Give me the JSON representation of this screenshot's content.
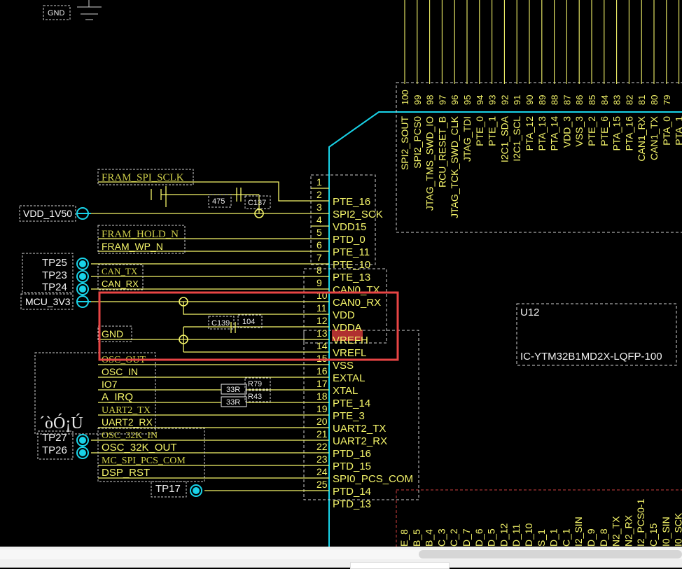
{
  "colors": {
    "wire": "#f5f56a",
    "body": "#19d3e8",
    "highlight": "#e84545",
    "vdda_bg": "#b03030",
    "tp": "#19d3e8",
    "dashed": "#cfcfcf",
    "dashed_red": "#d04040"
  },
  "ic": {
    "ref": "U12",
    "part": "IC-YTM32B1MD2X-LQFP-100",
    "left_pins": [
      {
        "num": "1",
        "name": ""
      },
      {
        "num": "2",
        "name": "PTE_16"
      },
      {
        "num": "3",
        "name": "SPI2_SCK"
      },
      {
        "num": "4",
        "name": "VDD15"
      },
      {
        "num": "5",
        "name": "PTD_0"
      },
      {
        "num": "6",
        "name": "PTE_11"
      },
      {
        "num": "7",
        "name": "PTE_10"
      },
      {
        "num": "8",
        "name": "PTE_13"
      },
      {
        "num": "9",
        "name": "CAN0_TX"
      },
      {
        "num": "10",
        "name": "CAN0_RX"
      },
      {
        "num": "11",
        "name": "VDD"
      },
      {
        "num": "12",
        "name": "VDDA"
      },
      {
        "num": "13",
        "name": "VREFH"
      },
      {
        "num": "14",
        "name": "VREFL"
      },
      {
        "num": "15",
        "name": "VSS"
      },
      {
        "num": "16",
        "name": "EXTAL"
      },
      {
        "num": "17",
        "name": "XTAL"
      },
      {
        "num": "18",
        "name": "PTE_14"
      },
      {
        "num": "19",
        "name": "PTE_3"
      },
      {
        "num": "20",
        "name": "UART2_TX"
      },
      {
        "num": "21",
        "name": "UART2_RX"
      },
      {
        "num": "22",
        "name": "PTD_16"
      },
      {
        "num": "23",
        "name": "PTD_15"
      },
      {
        "num": "24",
        "name": "SPI0_PCS_COM"
      },
      {
        "num": "25",
        "name": "PTD_14"
      },
      {
        "num": "",
        "name": "PTD_13"
      }
    ],
    "top_pins": [
      {
        "num": "100",
        "name": "SPI2_SOUT"
      },
      {
        "num": "99",
        "name": "SPI2_PCS0"
      },
      {
        "num": "98",
        "name": "JTAG_TMS_SWD_IO"
      },
      {
        "num": "97",
        "name": "RCU_RESET_B"
      },
      {
        "num": "96",
        "name": "JTAG_TCK_SWD_CLK"
      },
      {
        "num": "95",
        "name": "JTAG_TDI"
      },
      {
        "num": "94",
        "name": "PTE_0"
      },
      {
        "num": "93",
        "name": "PTE_1"
      },
      {
        "num": "92",
        "name": "I2C1_SDA"
      },
      {
        "num": "91",
        "name": "I2C1_SCL"
      },
      {
        "num": "90",
        "name": "PTA_12"
      },
      {
        "num": "89",
        "name": "PTA_13"
      },
      {
        "num": "88",
        "name": "PTA_14"
      },
      {
        "num": "87",
        "name": "VDD_3"
      },
      {
        "num": "86",
        "name": "VSS_3"
      },
      {
        "num": "85",
        "name": "PTE_2"
      },
      {
        "num": "84",
        "name": "PTE_6"
      },
      {
        "num": "83",
        "name": "PTA_15"
      },
      {
        "num": "82",
        "name": "PTA_16"
      },
      {
        "num": "81",
        "name": "CAN1_RX"
      },
      {
        "num": "80",
        "name": "CAN1_TX"
      },
      {
        "num": "79",
        "name": "PTA_0"
      },
      {
        "num": "",
        "name": "PTA_1"
      }
    ],
    "bottom_pins": [
      "E_8",
      "B_5",
      "B_4",
      "C_3",
      "C_2",
      "D_7",
      "D_6",
      "D_5",
      "D_12",
      "D_11",
      "D_10",
      "S_1",
      "D_1",
      "C_1",
      "I2_SIN",
      "D_9",
      "D_8",
      "N2_TX",
      "N2_RX",
      "I2_PCS0-1",
      "C_15",
      "I0_SIN",
      "I0_SCK"
    ]
  },
  "nets": {
    "gnd_top": "GND",
    "fram_spi_sclk": "FRAM_SPI_SCLK",
    "vdd_1v50": "VDD_1V50",
    "fram_hold_n": "FRAM_HOLD_N",
    "fram_wp_n": "FRAM_WP_N",
    "can_tx": "CAN_TX",
    "can_rx": "CAN_RX",
    "mcu_3v3": "MCU_3V3",
    "gnd": "GND",
    "osc_out": "OSC_OUT",
    "osc_in": "OSC_IN",
    "io7": "IO7",
    "a_irq": "A_IRQ",
    "uart2_tx": "UART2_TX",
    "uart2_rx": "UART2_RX",
    "osc_32k_in": "OSC_32K_IN",
    "osc_32k_out": "OSC_32K_OUT",
    "mc_spi_pcs_com": "MC_SPI_PCS_COM",
    "dsp_rst": "DSP_RST"
  },
  "testpoints": [
    "TP25",
    "TP23",
    "TP24",
    "TP27",
    "TP26",
    "TP17"
  ],
  "components": {
    "c475": "475",
    "c137": "C137",
    "c139": "C139",
    "c104": "104",
    "r79": "R79",
    "r43": "R43",
    "r_val": "33R"
  },
  "garbled_text": "´òÓ¡Ú"
}
